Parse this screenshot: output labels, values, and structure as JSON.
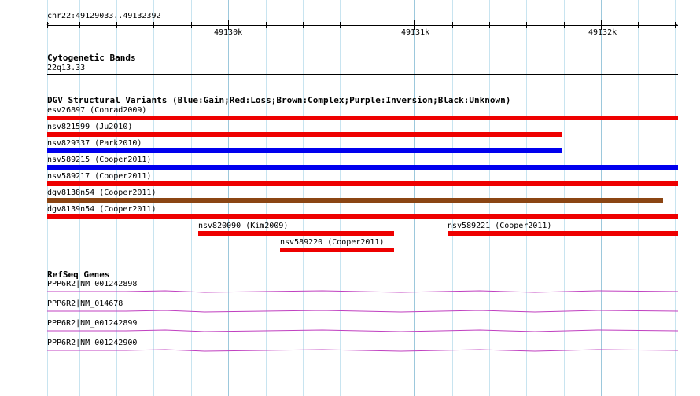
{
  "ruler": {
    "location": "chr22:49129033..49132392",
    "ticks": [
      "49130k",
      "49131k",
      "49132k"
    ]
  },
  "cytoband": {
    "title": "Cytogenetic Bands",
    "band": "22q13.33"
  },
  "dgv": {
    "title": "DGV Structural Variants (Blue:Gain;Red:Loss;Brown:Complex;Purple:Inversion;Black:Unknown)",
    "colors": {
      "gain": "#0000ee",
      "loss": "#ee0000",
      "complex": "#8b4513"
    },
    "variants": [
      {
        "label": "esv26897 (Conrad2009)",
        "type": "loss"
      },
      {
        "label": "nsv821599 (Ju2010)",
        "type": "loss"
      },
      {
        "label": "nsv829337 (Park2010)",
        "type": "gain"
      },
      {
        "label": "nsv589215 (Cooper2011)",
        "type": "gain"
      },
      {
        "label": "nsv589217 (Cooper2011)",
        "type": "loss"
      },
      {
        "label": "dgv8138n54 (Cooper2011)",
        "type": "complex"
      },
      {
        "label": "dgv8139n54 (Cooper2011)",
        "type": "loss"
      },
      {
        "label": "nsv820090 (Kim2009)",
        "type": "loss"
      },
      {
        "label": "nsv589221 (Cooper2011)",
        "type": "loss"
      },
      {
        "label": "nsv589220 (Cooper2011)",
        "type": "loss"
      }
    ]
  },
  "refseq": {
    "title": "RefSeq Genes",
    "color": "#c040c0",
    "genes": [
      {
        "label": "PPP6R2|NM_001242898"
      },
      {
        "label": "PPP6R2|NM_014678"
      },
      {
        "label": "PPP6R2|NM_001242899"
      },
      {
        "label": "PPP6R2|NM_001242900"
      }
    ]
  }
}
